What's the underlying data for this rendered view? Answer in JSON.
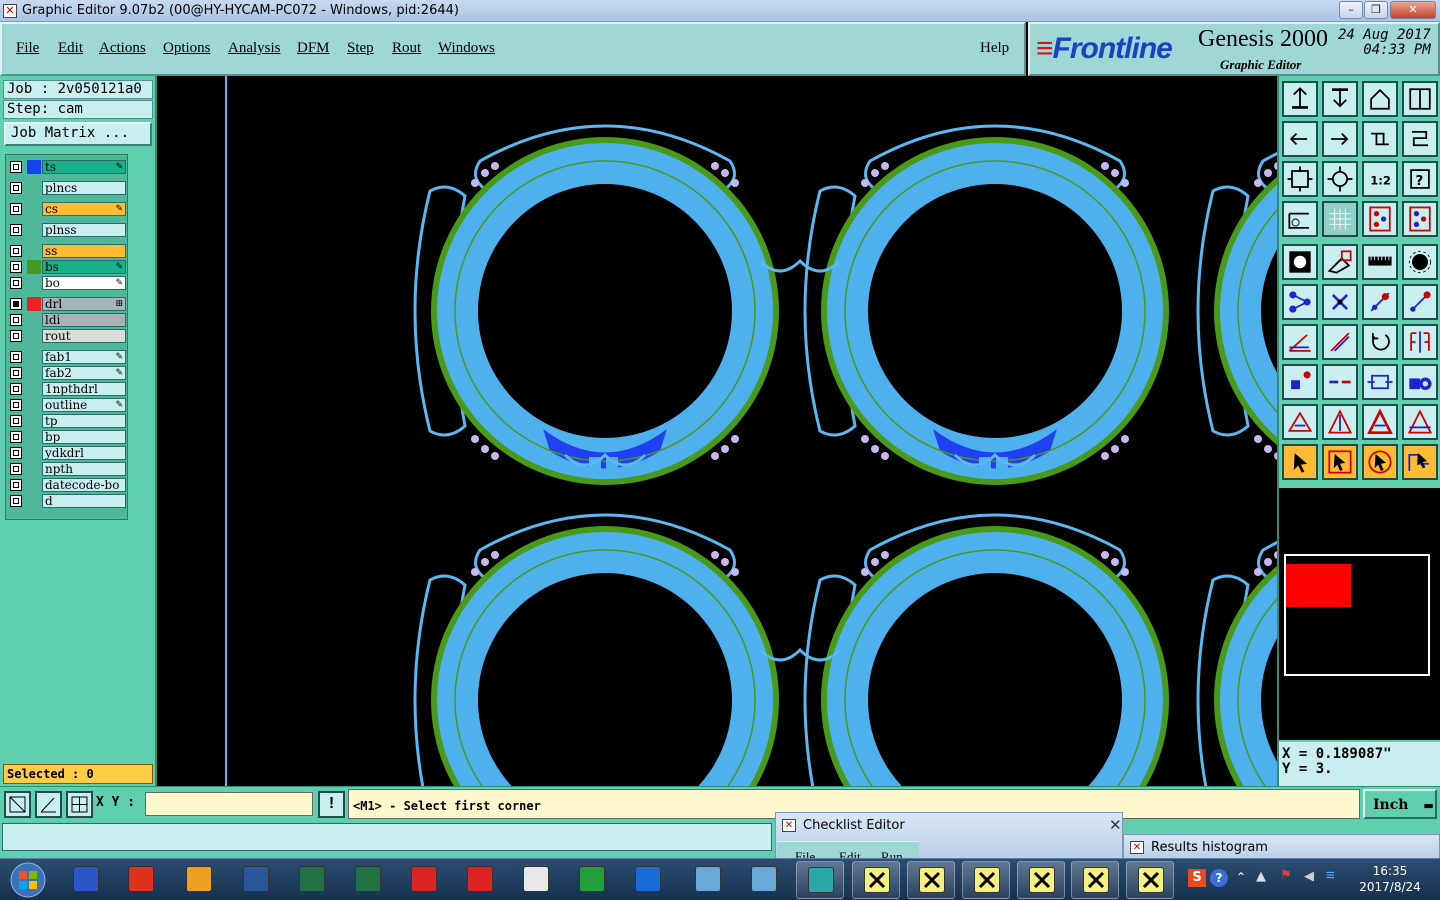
{
  "window": {
    "title": "Graphic Editor 9.07b2 (00@HY-HYCAM-PC072 - Windows, pid:2644)",
    "controls": {
      "minimize": "–",
      "restore": "❐",
      "close": "✕"
    }
  },
  "menubar": {
    "items": [
      "File",
      "Edit",
      "Actions",
      "Options",
      "Analysis",
      "DFM",
      "Step",
      "Rout",
      "Windows"
    ],
    "help": "Help"
  },
  "brand": {
    "logo": "Frontline",
    "product": "Genesis 2000",
    "date": "24 Aug 2017",
    "time": "04:33 PM",
    "subtitle": "Graphic Editor"
  },
  "job": {
    "job_line": "Job : 2v050121a0",
    "step_line": "Step: cam",
    "job_matrix": "Job Matrix ..."
  },
  "layers": [
    {
      "name": "ts",
      "color": "#18b08a",
      "swatch": "#1144ee",
      "icon": "pen-icon",
      "icon_glyph": "✎",
      "checked": false
    },
    {
      "name": "plncs",
      "color": "#c8eef0",
      "swatch": "",
      "icon": "",
      "icon_glyph": "",
      "checked": false
    },
    {
      "name": "cs",
      "color": "#ffbb33",
      "swatch": "",
      "icon": "pen-icon",
      "icon_glyph": "✎",
      "checked": false
    },
    {
      "name": "plnss",
      "color": "#c8eef0",
      "swatch": "",
      "icon": "",
      "icon_glyph": "",
      "checked": false
    },
    {
      "name": "ss",
      "color": "#ffbb33",
      "swatch": "",
      "icon": "",
      "icon_glyph": "",
      "checked": false
    },
    {
      "name": "bs",
      "color": "#18b08a",
      "swatch": "#449922",
      "icon": "pen-icon",
      "icon_glyph": "✎",
      "checked": false
    },
    {
      "name": "bo",
      "color": "#ffffff",
      "swatch": "",
      "icon": "pen-icon",
      "icon_glyph": "✎",
      "checked": false
    },
    {
      "name": "drl",
      "color": "#a8b4b8",
      "swatch": "#ee2222",
      "icon": "grid-icon",
      "icon_glyph": "⊞",
      "checked": true
    },
    {
      "name": "ldi",
      "color": "#a8b4b8",
      "swatch": "",
      "icon": "",
      "icon_glyph": "",
      "checked": false
    },
    {
      "name": "rout",
      "color": "#dcdcdc",
      "swatch": "",
      "icon": "",
      "icon_glyph": "",
      "checked": false
    },
    {
      "name": "fab1",
      "color": "#c8eef0",
      "swatch": "",
      "icon": "pen-icon",
      "icon_glyph": "✎",
      "checked": false
    },
    {
      "name": "fab2",
      "color": "#c8eef0",
      "swatch": "",
      "icon": "pen-icon",
      "icon_glyph": "✎",
      "checked": false
    },
    {
      "name": "1npthdrl",
      "color": "#c8eef0",
      "swatch": "",
      "icon": "",
      "icon_glyph": "",
      "checked": false
    },
    {
      "name": "outline",
      "color": "#c8eef0",
      "swatch": "",
      "icon": "pen-icon",
      "icon_glyph": "✎",
      "checked": false
    },
    {
      "name": "tp",
      "color": "#c8eef0",
      "swatch": "",
      "icon": "",
      "icon_glyph": "",
      "checked": false
    },
    {
      "name": "bp",
      "color": "#c8eef0",
      "swatch": "",
      "icon": "",
      "icon_glyph": "",
      "checked": false
    },
    {
      "name": "ydkdrl",
      "color": "#c8eef0",
      "swatch": "",
      "icon": "",
      "icon_glyph": "",
      "checked": false
    },
    {
      "name": "npth",
      "color": "#c8eef0",
      "swatch": "",
      "icon": "",
      "icon_glyph": "",
      "checked": false
    },
    {
      "name": "datecode-bo",
      "color": "#c8eef0",
      "swatch": "",
      "icon": "",
      "icon_glyph": "",
      "checked": false
    },
    {
      "name": "d",
      "color": "#c8eef0",
      "swatch": "",
      "icon": "",
      "icon_glyph": "",
      "checked": false
    }
  ],
  "selected": "Selected : 0",
  "coords": {
    "x": "X = 0.189087\"",
    "y": "Y = 3."
  },
  "cmd": {
    "xy_label": "X Y :",
    "xy_value": "",
    "warn": "!",
    "message": "<M1> - Select first corner",
    "unit": "Inch",
    "unit_arrow": "▬"
  },
  "subwindows": {
    "checklist": {
      "title": "Checklist Editor",
      "menu": [
        "File",
        "Edit",
        "Run"
      ]
    },
    "histogram": {
      "title": "Results histogram"
    }
  },
  "taskbar": {
    "time": "16:35",
    "date": "2017/8/24"
  },
  "colors": {
    "panel": "#5fcfb0",
    "field": "#c8eef0",
    "pad_fill": "#4fb0ee",
    "ring_green": "#4a9a1a",
    "thin_outline": "#5ab8f2",
    "mask_blue": "#1f40f0"
  },
  "tools": [
    "layer-up-icon",
    "layer-down-icon",
    "home-icon",
    "split-window-icon",
    "pan-left-icon",
    "pan-right-icon",
    "swap-icon",
    "snap-icon",
    "zoom-fit-icon",
    "zoom-center-icon",
    "zoom-1to2-icon",
    "help-icon",
    "measure-tool-icon",
    "grid-icon",
    "traffic-light-icon",
    "traffic-light-alt-icon",
    "photo-icon",
    "erase-icon",
    "ruler-icon",
    "record-icon",
    "connect-nodes-icon",
    "delete-node-icon",
    "add-node-icon",
    "move-node-icon",
    "angle-icon",
    "line-edit-icon",
    "rotate-icon",
    "mirror-icon",
    "select-pad-icon",
    "split-line-icon",
    "resize-icon",
    "shapes-icon",
    "triangle-add-icon",
    "triangle-up-icon",
    "triangle-a-icon",
    "triangle-b-icon",
    "pointer-icon",
    "pointer-box-icon",
    "pointer-circle-icon",
    "pointer-path-icon"
  ]
}
